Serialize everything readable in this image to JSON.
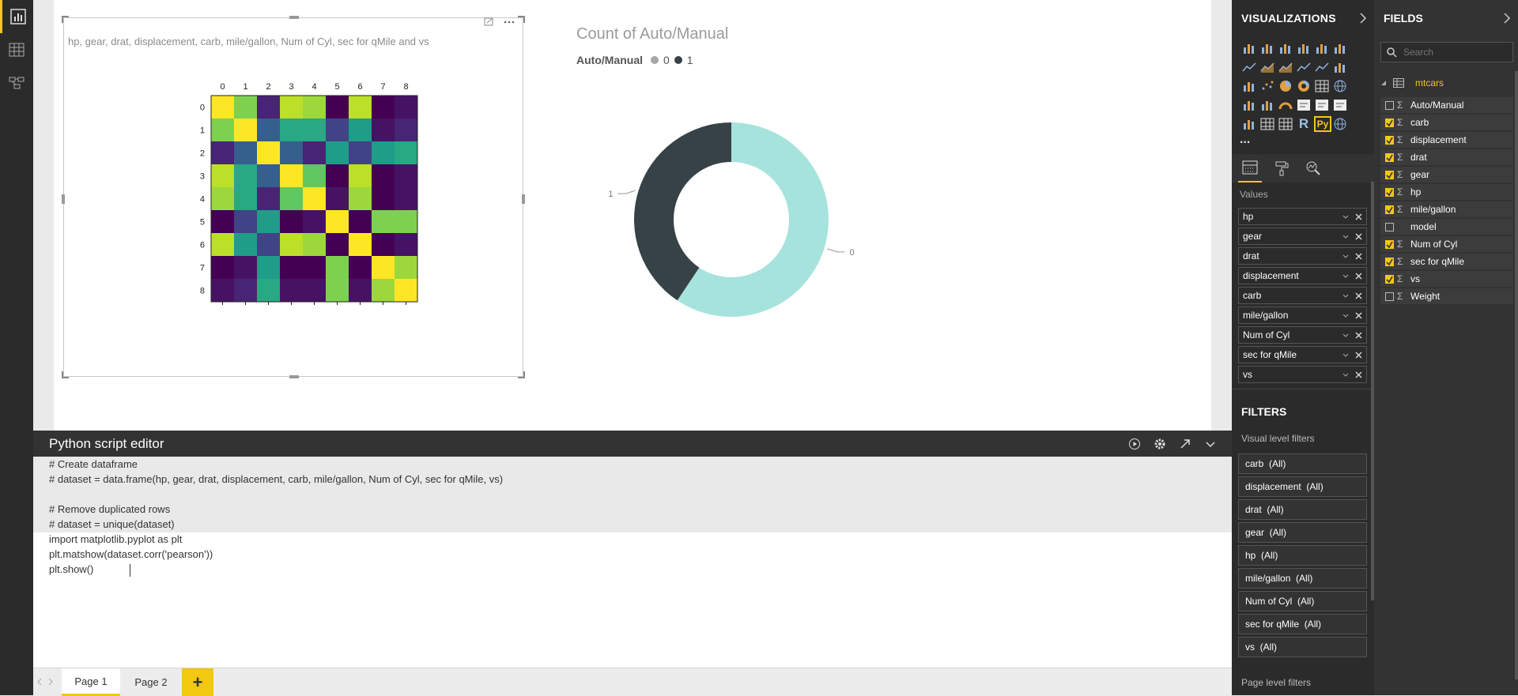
{
  "heatmap_visual": {
    "title": "hp, gear, drat, displacement, carb, mile/gallon, Num of Cyl, sec for qMile and vs",
    "col_ticks": [
      "0",
      "1",
      "2",
      "3",
      "4",
      "5",
      "6",
      "7",
      "8"
    ],
    "row_ticks": [
      "0",
      "1",
      "2",
      "3",
      "4",
      "5",
      "6",
      "7",
      "8"
    ]
  },
  "donut_visual": {
    "title": "Count of Auto/Manual",
    "legend_title": "Auto/Manual",
    "legend_items": [
      "0",
      "1"
    ],
    "label_0": "0",
    "label_1": "1",
    "colors": {
      "0": "#a6e3dd",
      "1": "#374247"
    }
  },
  "chart_data": [
    {
      "type": "heatmap",
      "title": "hp, gear, drat, displacement, carb, mile/gallon, Num of Cyl, sec for qMile and vs",
      "x": [
        "0",
        "1",
        "2",
        "3",
        "4",
        "5",
        "6",
        "7",
        "8"
      ],
      "y": [
        "0",
        "1",
        "2",
        "3",
        "4",
        "5",
        "6",
        "7",
        "8"
      ],
      "matrix": [
        [
          1.0,
          0.8,
          0.1,
          0.9,
          0.85,
          0.0,
          0.9,
          0.0,
          0.05
        ],
        [
          0.8,
          1.0,
          0.3,
          0.6,
          0.6,
          0.2,
          0.55,
          0.05,
          0.1
        ],
        [
          0.1,
          0.3,
          1.0,
          0.3,
          0.1,
          0.55,
          0.2,
          0.55,
          0.6
        ],
        [
          0.9,
          0.6,
          0.3,
          1.0,
          0.75,
          0.0,
          0.9,
          0.0,
          0.05
        ],
        [
          0.85,
          0.6,
          0.1,
          0.75,
          1.0,
          0.05,
          0.85,
          0.0,
          0.05
        ],
        [
          0.0,
          0.2,
          0.55,
          0.0,
          0.05,
          1.0,
          0.0,
          0.8,
          0.8
        ],
        [
          0.9,
          0.55,
          0.2,
          0.9,
          0.85,
          0.0,
          1.0,
          0.0,
          0.05
        ],
        [
          0.0,
          0.05,
          0.55,
          0.0,
          0.0,
          0.8,
          0.0,
          1.0,
          0.85
        ],
        [
          0.05,
          0.1,
          0.6,
          0.05,
          0.05,
          0.8,
          0.05,
          0.85,
          1.0
        ]
      ]
    },
    {
      "type": "pie",
      "title": "Count of Auto/Manual",
      "categories": [
        "0",
        "1"
      ],
      "values": [
        19,
        13
      ],
      "legend": "top-left"
    }
  ],
  "editor": {
    "title": "Python script editor",
    "lines": [
      "# Create dataframe",
      "# dataset = data.frame(hp, gear, drat, displacement, carb, mile/gallon, Num of Cyl, sec for qMile, vs)",
      "",
      "# Remove duplicated rows",
      "# dataset = unique(dataset)",
      "import matplotlib.pyplot as plt",
      "plt.matshow(dataset.corr('pearson'))",
      "plt.show()"
    ]
  },
  "pages": {
    "tabs": [
      "Page 1",
      "Page 2"
    ],
    "add": "+"
  },
  "viz_pane": {
    "title": "VISUALIZATIONS",
    "more": "...",
    "values_label": "Values",
    "wells": [
      "hp",
      "gear",
      "drat",
      "displacement",
      "carb",
      "mile/gallon",
      "Num of Cyl",
      "sec for qMile",
      "vs"
    ],
    "filters_title": "FILTERS",
    "visual_filters_label": "Visual level filters",
    "filters": [
      "carb  (All)",
      "displacement  (All)",
      "drat  (All)",
      "gear  (All)",
      "hp  (All)",
      "mile/gallon  (All)",
      "Num of Cyl  (All)",
      "sec for qMile  (All)",
      "vs  (All)"
    ],
    "page_filters_label": "Page level filters"
  },
  "fields_pane": {
    "title": "FIELDS",
    "search_placeholder": "Search",
    "table": "mtcars",
    "fields": [
      {
        "name": "Auto/Manual",
        "checked": false,
        "sigma": true
      },
      {
        "name": "carb",
        "checked": true,
        "sigma": true
      },
      {
        "name": "displacement",
        "checked": true,
        "sigma": true
      },
      {
        "name": "drat",
        "checked": true,
        "sigma": true
      },
      {
        "name": "gear",
        "checked": true,
        "sigma": true
      },
      {
        "name": "hp",
        "checked": true,
        "sigma": true
      },
      {
        "name": "mile/gallon",
        "checked": true,
        "sigma": true
      },
      {
        "name": "model",
        "checked": false,
        "sigma": false
      },
      {
        "name": "Num of Cyl",
        "checked": true,
        "sigma": true
      },
      {
        "name": "sec for qMile",
        "checked": true,
        "sigma": true
      },
      {
        "name": "vs",
        "checked": true,
        "sigma": true
      },
      {
        "name": "Weight",
        "checked": false,
        "sigma": true
      }
    ]
  },
  "colors": {
    "accent": "#f2c811",
    "pane_dark": "#2b2b2b"
  }
}
